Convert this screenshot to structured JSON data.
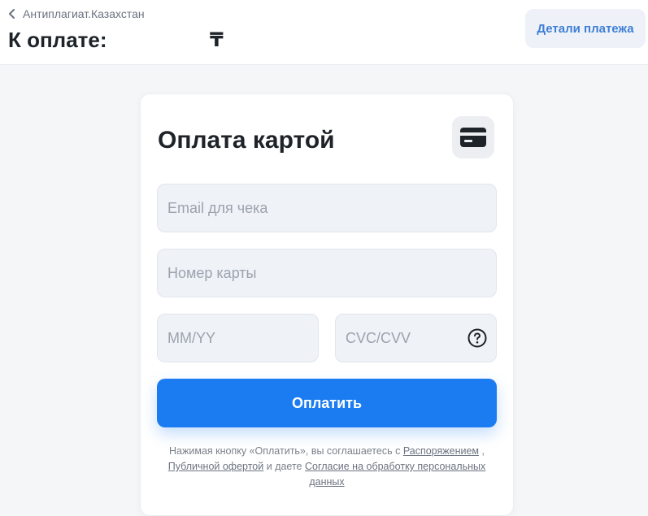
{
  "header": {
    "back_label": "Антиплагиат.Казахстан",
    "amount_label": "К оплате:",
    "currency_symbol": "₸",
    "details_button": "Детали платежа"
  },
  "payment_form": {
    "title": "Оплата картой",
    "email_placeholder": "Email для чека",
    "card_number_placeholder": "Номер карты",
    "expiry_placeholder": "MM/YY",
    "cvc_placeholder": "CVC/CVV",
    "pay_button": "Оплатить"
  },
  "terms": {
    "prefix": "Нажимая кнопку «Оплатить», вы соглашаетесь с",
    "link_order": "Распоряжением",
    "sep1": ",",
    "link_offer": "Публичной офертой",
    "middle": "и даете",
    "link_consent": "Согласие на обработку персональных данных"
  },
  "colors": {
    "accent": "#1a7cf0",
    "details_text": "#3f7fd6",
    "field_bg": "#eff2f7",
    "page_bg": "#f5f6f8"
  },
  "icons": {
    "back": "chevron-left-icon",
    "card": "credit-card-icon",
    "help": "question-circle-icon"
  }
}
